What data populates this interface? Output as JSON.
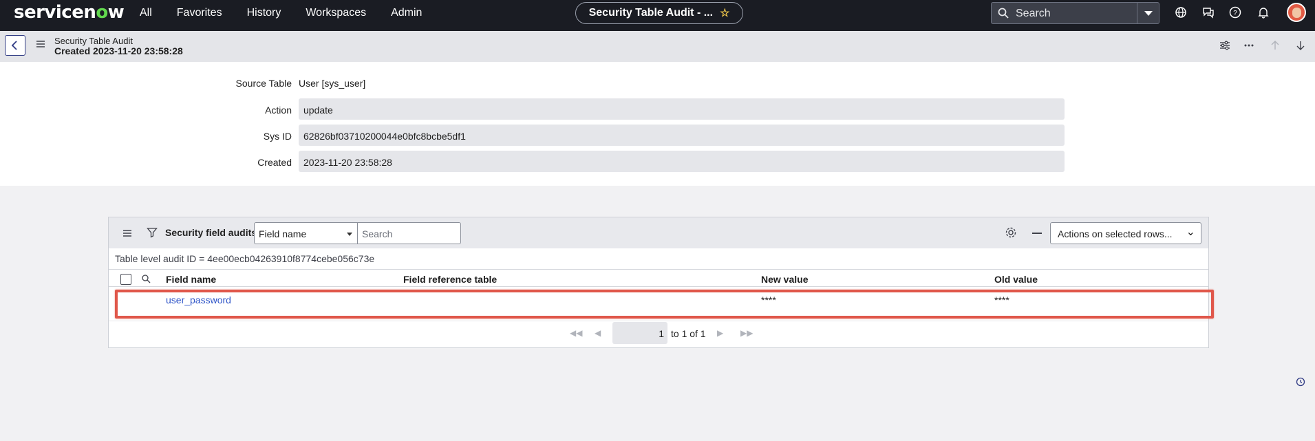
{
  "nav": {
    "logo_prefix": "servicen",
    "logo_o": "o",
    "logo_suffix": "w",
    "links": [
      "All",
      "Favorites",
      "History",
      "Workspaces",
      "Admin"
    ],
    "context_pill": "Security Table Audit - ...",
    "search_placeholder": "Search"
  },
  "record": {
    "type": "Security Table Audit",
    "created_line": "Created 2023-11-20 23:58:28"
  },
  "form": {
    "source_table_label": "Source Table",
    "source_table_value": "User [sys_user]",
    "action_label": "Action",
    "action_value": "update",
    "sys_id_label": "Sys ID",
    "sys_id_value": "62826bf03710200044e0bfc8bcbe5df1",
    "created_label": "Created",
    "created_value": "2023-11-20 23:58:28"
  },
  "related_list": {
    "title": "Security field audits",
    "field_select": "Field name",
    "search_placeholder": "Search",
    "actions_select": "Actions on selected rows...",
    "breadcrumb": "Table level audit ID = 4ee00ecb04263910f8774cebe056c73e",
    "columns": [
      "Field name",
      "Field reference table",
      "New value",
      "Old value"
    ],
    "rows": [
      {
        "field_name": "user_password",
        "field_reference_table": "",
        "new_value": "****",
        "old_value": "****"
      }
    ],
    "pager": {
      "current": "1",
      "text": "to 1 of 1"
    }
  }
}
